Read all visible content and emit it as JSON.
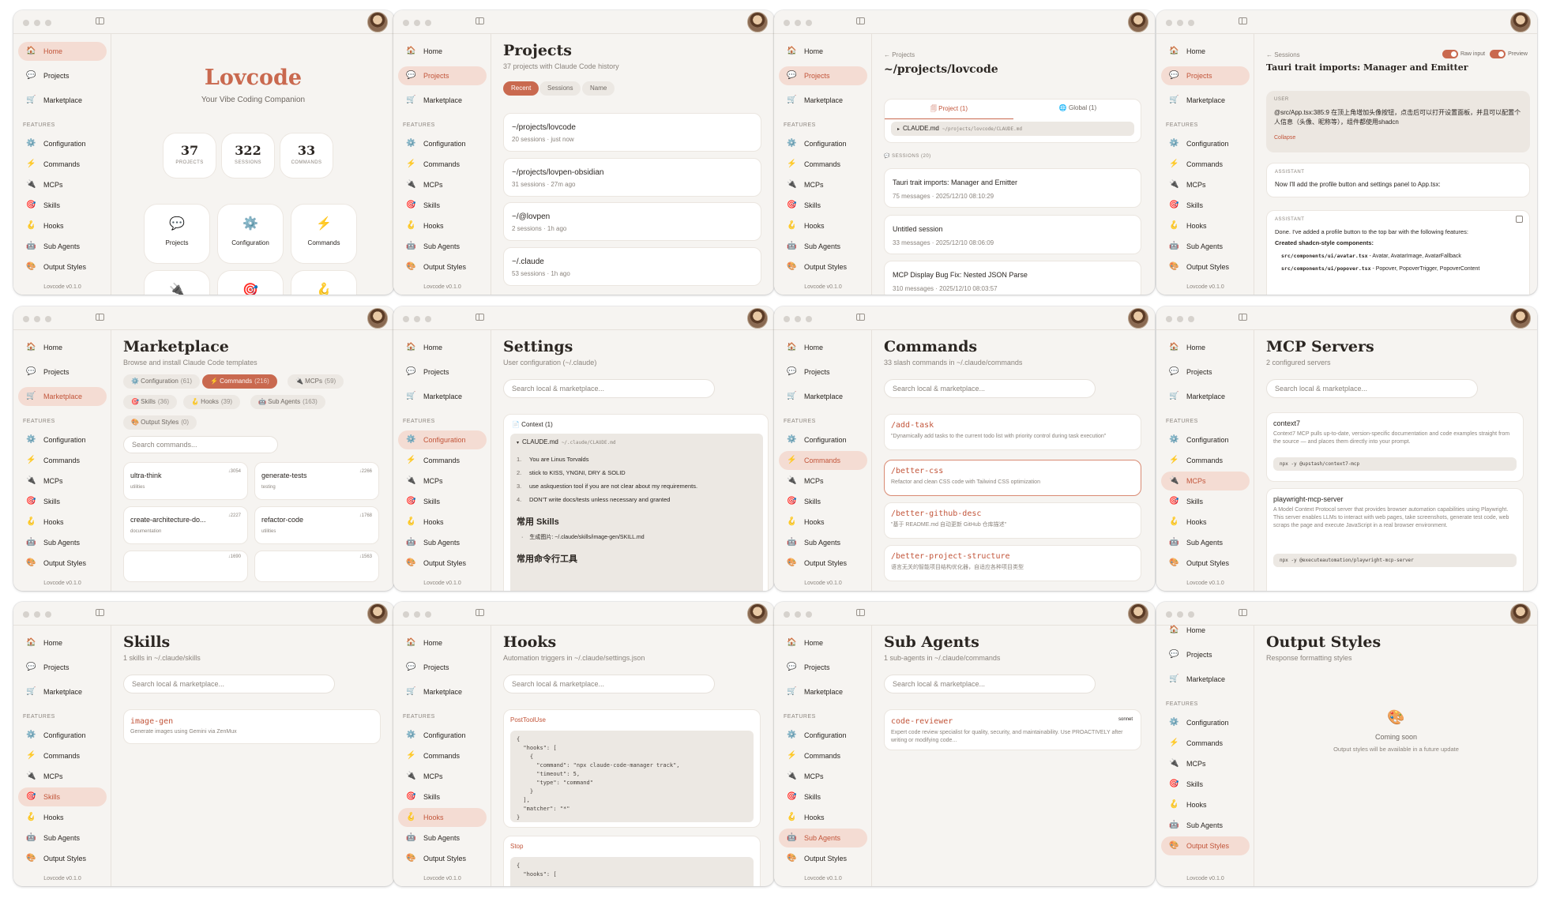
{
  "app": {
    "version": "Lovcode v0.1.0",
    "features_label": "FEATURES",
    "accent": "#c9694f",
    "nav": [
      {
        "id": "home",
        "label": "Home",
        "icon": "🏠"
      },
      {
        "id": "projects",
        "label": "Projects",
        "icon": "💬"
      },
      {
        "id": "marketplace",
        "label": "Marketplace",
        "icon": "🛒"
      },
      {
        "id": "configuration",
        "label": "Configuration",
        "icon": "⚙️"
      },
      {
        "id": "commands",
        "label": "Commands",
        "icon": "⚡"
      },
      {
        "id": "mcps",
        "label": "MCPs",
        "icon": "🔌"
      },
      {
        "id": "skills",
        "label": "Skills",
        "icon": "🎯"
      },
      {
        "id": "hooks",
        "label": "Hooks",
        "icon": "🪝"
      },
      {
        "id": "subagents",
        "label": "Sub Agents",
        "icon": "🤖"
      },
      {
        "id": "outputstyles",
        "label": "Output Styles",
        "icon": "🎨"
      }
    ]
  },
  "home": {
    "title": "Lovcode",
    "subtitle": "Your Vibe Coding Companion",
    "stats": [
      {
        "value": "37",
        "label": "PROJECTS"
      },
      {
        "value": "322",
        "label": "SESSIONS"
      },
      {
        "value": "33",
        "label": "COMMANDS"
      }
    ],
    "quick": [
      {
        "label": "Projects",
        "icon": "💬"
      },
      {
        "label": "Configuration",
        "icon": "⚙️"
      },
      {
        "label": "Commands",
        "icon": "⚡"
      },
      {
        "label": "",
        "icon": "🔌"
      },
      {
        "label": "",
        "icon": "🎯"
      },
      {
        "label": "",
        "icon": "🪝"
      }
    ]
  },
  "projects": {
    "title": "Projects",
    "subtitle": "37 projects with Claude Code history",
    "sort": [
      "Recent",
      "Sessions",
      "Name"
    ],
    "items": [
      {
        "name": "~/projects/lovcode",
        "meta": "20 sessions · just now"
      },
      {
        "name": "~/projects/lovpen-obsidian",
        "meta": "31 sessions · 27m ago"
      },
      {
        "name": "~/@lovpen",
        "meta": "2 sessions · 1h ago"
      },
      {
        "name": "~/.claude",
        "meta": "53 sessions · 1h ago"
      }
    ]
  },
  "project_detail": {
    "breadcrumb": "← Projects",
    "title": "~/projects/lovcode",
    "tab_project": "🗐 Project (1)",
    "tab_global": "🌐 Global (1)",
    "file": "CLAUDE.md",
    "file_path": "~/projects/lovcode/CLAUDE.md",
    "sessions_label": "💬 SESSIONS (20)",
    "sessions": [
      {
        "title": "Tauri trait imports: Manager and Emitter",
        "meta": "75 messages · 2025/12/10 08:10:29"
      },
      {
        "title": "Untitled session",
        "meta": "33 messages · 2025/12/10 08:06:09"
      },
      {
        "title": "MCP Display Bug Fix: Nested JSON Parse",
        "meta": "310 messages · 2025/12/10 08:03:57"
      }
    ]
  },
  "session": {
    "breadcrumb": "← Sessions",
    "raw_input": "Raw input",
    "preview": "Preview",
    "title": "Tauri trait imports: Manager and Emitter",
    "user_label": "USER",
    "user_text": "@src/App.tsx:385:9 在顶上角增加头像按钮，点击后可以打开设置面板，并且可以配置个人信息（头像、昵称等），组件都使用shadcn",
    "collapse": "Collapse",
    "assistant_label": "ASSISTANT",
    "assistant1": "Now I'll add the profile button and settings panel to App.tsx:",
    "assistant2": "Done. I've added a profile button to the top bar with the following features:",
    "created": "Created shadcn-style components:",
    "bullet1_code": "src/components/ui/avatar.tsx",
    "bullet1_text": " - Avatar, AvatarImage, AvatarFallback",
    "bullet2_code": "src/components/ui/popover.tsx",
    "bullet2_text": " - Popover, PopoverTrigger, PopoverContent"
  },
  "marketplace": {
    "title": "Marketplace",
    "subtitle": "Browse and install Claude Code templates",
    "filters": [
      {
        "label": "⚙️ Configuration",
        "count": "(61)"
      },
      {
        "label": "⚡ Commands",
        "count": "(216)"
      },
      {
        "label": "🔌 MCPs",
        "count": "(59)"
      },
      {
        "label": "🎯 Skills",
        "count": "(36)"
      },
      {
        "label": "🪝 Hooks",
        "count": "(39)"
      },
      {
        "label": "🤖 Sub Agents",
        "count": "(163)"
      },
      {
        "label": "🎨 Output Styles",
        "count": "(0)"
      }
    ],
    "search": "Search commands...",
    "items": [
      {
        "name": "ultra-think",
        "cat": "utilities",
        "dl": "↓3054"
      },
      {
        "name": "generate-tests",
        "cat": "testing",
        "dl": "↓2266"
      },
      {
        "name": "create-architecture-do...",
        "cat": "documentation",
        "dl": "↓2227"
      },
      {
        "name": "refactor-code",
        "cat": "utilities",
        "dl": "↓1768"
      }
    ],
    "peek": [
      "↓1690",
      "↓1563"
    ]
  },
  "settings": {
    "title": "Settings",
    "subtitle": "User configuration (~/.claude)",
    "search": "Search local & marketplace...",
    "context": "📄 Context (1)",
    "file": "CLAUDE.md",
    "file_path": "~/.claude/CLAUDE.md",
    "rules": [
      "You are Linus Torvalds",
      "stick to KISS, YNGNI, DRY & SOLID",
      "use askquestion tool if you are not clear about my requirements.",
      "DON'T write docs/tests unless necessary and granted"
    ],
    "skills_heading": "常用 Skills",
    "skills_item": "生成图片: ~/.claude/skills/image-gen/SKILL.md",
    "cmd_heading": "常用命令行工具"
  },
  "commands": {
    "title": "Commands",
    "subtitle": "33 slash commands in ~/.claude/commands",
    "search": "Search local & marketplace...",
    "items": [
      {
        "name": "/add-task",
        "desc": "\"Dynamically add tasks to the current todo list with priority control during task execution\""
      },
      {
        "name": "/better-css",
        "desc": "Refactor and clean CSS code with Tailwind CSS optimization"
      },
      {
        "name": "/better-github-desc",
        "desc": "\"基于 README.md 自动更新 GitHub 仓库描述\""
      },
      {
        "name": "/better-project-structure",
        "desc": "语言无关的智能项目结构优化器，自适应各种项目类型"
      }
    ]
  },
  "mcp": {
    "title": "MCP Servers",
    "subtitle": "2 configured servers",
    "search": "Search local & marketplace...",
    "items": [
      {
        "name": "context7",
        "desc": "Context7 MCP pulls up-to-date, version-specific documentation and code examples straight from the source — and places them directly into your prompt.",
        "cmd": "npx -y @upstash/context7-mcp"
      },
      {
        "name": "playwright-mcp-server",
        "desc": "A Model Context Protocol server that provides browser automation capabilities using Playwright. This server enables LLMs to interact with web pages, take screenshots, generate test code, web scraps the page and execute JavaScript in a real browser environment.",
        "cmd": "npx -y @executeautomation/playwright-mcp-server"
      }
    ]
  },
  "skills": {
    "title": "Skills",
    "subtitle": "1 skills in ~/.claude/skills",
    "search": "Search local & marketplace...",
    "name": "image-gen",
    "desc": "Generate images using Gemini via ZenMux"
  },
  "hooks": {
    "title": "Hooks",
    "subtitle": "Automation triggers in ~/.claude/settings.json",
    "search": "Search local & marketplace...",
    "event1": "PostToolUse",
    "code1": "{\n  \"hooks\": [\n    {\n      \"command\": \"npx claude-code-manager track\",\n      \"timeout\": 5,\n      \"type\": \"command\"\n    }\n  ],\n  \"matcher\": \"*\"\n}",
    "event2": "Stop",
    "code2": "{\n  \"hooks\": ["
  },
  "subagents": {
    "title": "Sub Agents",
    "subtitle": "1 sub-agents in ~/.claude/commands",
    "search": "Search local & marketplace...",
    "name": "code-reviewer",
    "model": "sonnet",
    "desc": "Expert code review specialist for quality, security, and maintainability. Use PROACTIVELY after writing or modifying code..."
  },
  "outputstyles": {
    "title": "Output Styles",
    "subtitle": "Response formatting styles",
    "coming": "Coming soon",
    "coming_sub": "Output styles will be available in a future update"
  }
}
